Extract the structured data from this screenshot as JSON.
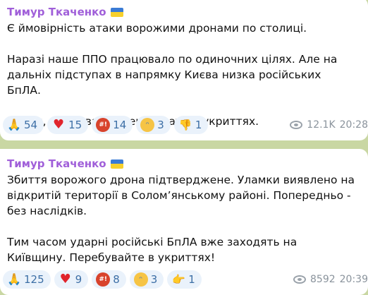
{
  "messages": [
    {
      "author": "Тимур Ткаченко",
      "text": "Є ймовірність атаки ворожими дронами по столиці.\n\nНаразі наше ППО працювало по одиночних цілях. Але на дальніх підступах в напрямку Києва низка російських БпЛА.\n\nКияни, зараз варто перебувати в укриттях.",
      "reactions": [
        {
          "icon": "pray-icon",
          "glyph": "🙏",
          "count": "54"
        },
        {
          "icon": "heart-icon",
          "glyph": "♥",
          "count": "15"
        },
        {
          "icon": "angry-face-icon",
          "glyph": "#!",
          "count": "14"
        },
        {
          "icon": "crying-face-icon",
          "glyph": "ᵔ",
          "count": "3"
        },
        {
          "icon": "thumbs-down-icon",
          "glyph": "👎",
          "count": "1"
        }
      ],
      "views": "12.1K",
      "time": "20:28"
    },
    {
      "author": "Тимур Ткаченко",
      "text": "Збиття ворожого дрона підтверджене. Уламки виявлено на відкритій території в Солом’янському районі. Попередньо - без наслідків.\n\nТим часом ударні російські БпЛА вже заходять на Київщину. Перебувайте в укриттях!",
      "reactions": [
        {
          "icon": "pray-icon",
          "glyph": "🙏",
          "count": "125"
        },
        {
          "icon": "heart-icon",
          "glyph": "♥",
          "count": "9"
        },
        {
          "icon": "angry-face-icon",
          "glyph": "#!",
          "count": "8"
        },
        {
          "icon": "crying-face-icon",
          "glyph": "ᵔ",
          "count": "3"
        },
        {
          "icon": "pointing-hand-icon",
          "glyph": "👉",
          "count": "1"
        }
      ],
      "views": "8592",
      "time": "20:39"
    }
  ]
}
